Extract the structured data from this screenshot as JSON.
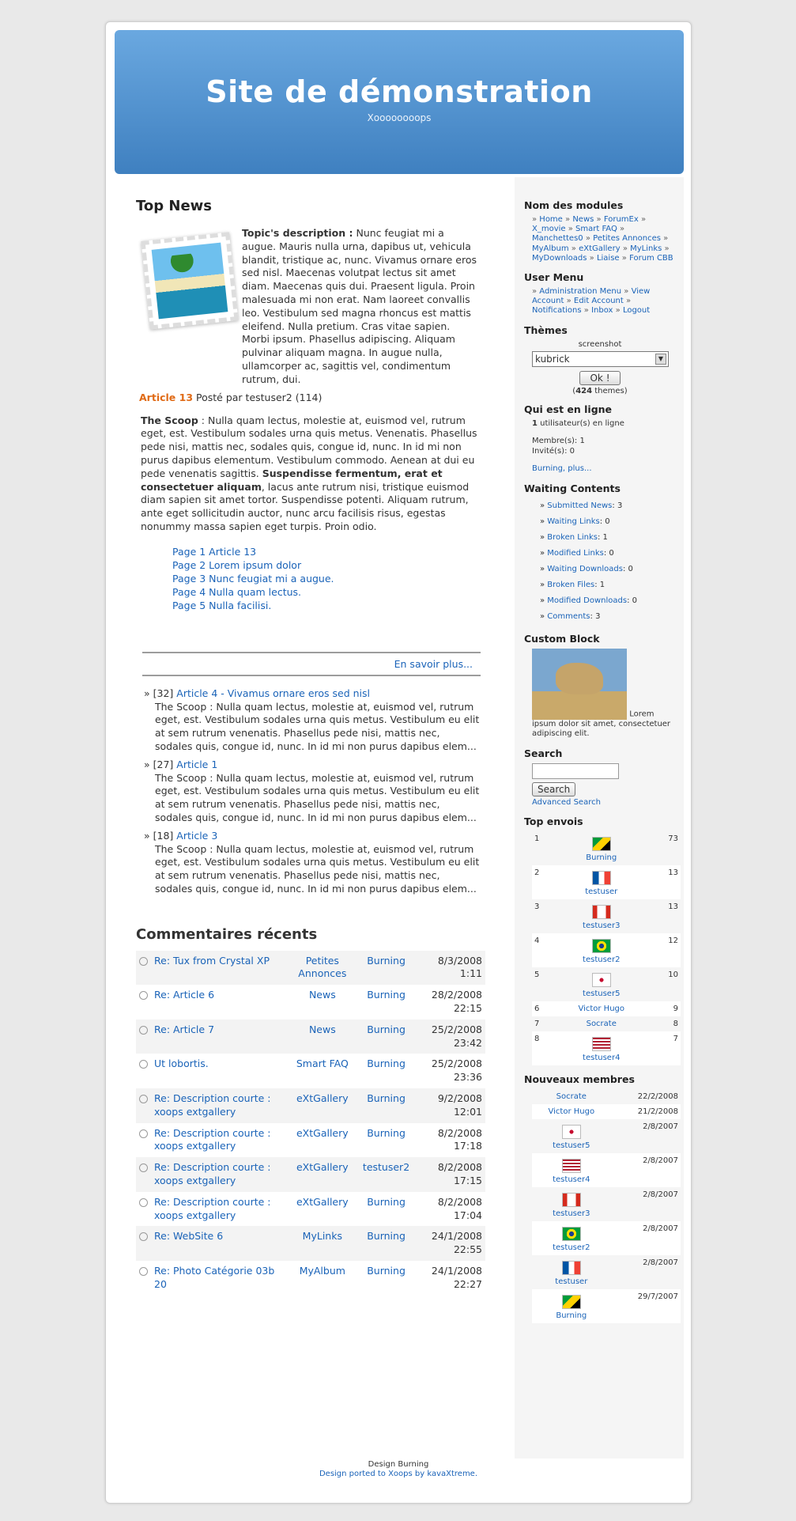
{
  "header": {
    "title": "Site de démonstration",
    "slogan": "Xoooooooops"
  },
  "topnews": {
    "title": "Top News",
    "desc_label": "Topic's description :",
    "desc_text": "Nunc feugiat mi a augue. Mauris nulla urna, dapibus ut, vehicula blandit, tristique ac, nunc. Vivamus ornare eros sed nisl. Maecenas volutpat lectus sit amet diam. Maecenas quis dui. Praesent ligula. Proin malesuada mi non erat. Nam laoreet convallis leo. Vestibulum sed magna rhoncus est mattis eleifend. Nulla pretium. Cras vitae sapien. Morbi ipsum. Phasellus adipiscing. Aliquam pulvinar aliquam magna. In augue nulla, ullamcorper ac, sagittis vel, condimentum rutrum, dui.",
    "article_link": "Article 13",
    "posted_by": "Posté par testuser2 (114)",
    "scoop_label": "The Scoop",
    "scoop_text1": ": Nulla quam lectus, molestie at, euismod vel, rutrum eget, est. Vestibulum sodales urna quis metus. Venenatis. Phasellus pede nisi, mattis nec, sodales quis, congue id, nunc. In id mi non purus dapibus elementum. Vestibulum commodo. Aenean at dui eu pede venenatis sagittis.",
    "scoop_bold": "Suspendisse fermentum, erat et consectetuer aliquam",
    "scoop_text2": ", lacus ante rutrum nisi, tristique euismod diam sapien sit amet tortor. Suspendisse potenti. Aliquam rutrum, ante eget sollicitudin auctor, nunc arcu facilisis risus, egestas nonummy massa sapien eget turpis. Proin odio.",
    "pages": [
      "Page 1 Article 13",
      "Page 2 Lorem ipsum dolor",
      "Page 3 Nunc feugiat mi a augue.",
      "Page 4 Nulla quam lectus.",
      "Page 5 Nulla facilisi."
    ],
    "more": "En savoir plus...",
    "list": [
      {
        "count": "» [32]",
        "title": "Article 4 - Vivamus ornare eros sed nisl",
        "summary": "The Scoop : Nulla quam lectus, molestie at, euismod vel, rutrum eget, est. Vestibulum sodales urna quis metus. Vestibulum eu elit at sem rutrum venenatis. Phasellus pede nisi, mattis nec, sodales quis, congue id, nunc. In id mi non purus dapibus elem..."
      },
      {
        "count": "» [27]",
        "title": "Article 1",
        "summary": "The Scoop : Nulla quam lectus, molestie at, euismod vel, rutrum eget, est. Vestibulum sodales urna quis metus. Vestibulum eu elit at sem rutrum venenatis. Phasellus pede nisi, mattis nec, sodales quis, congue id, nunc. In id mi non purus dapibus elem..."
      },
      {
        "count": "» [18]",
        "title": "Article 3",
        "summary": "The Scoop : Nulla quam lectus, molestie at, euismod vel, rutrum eget, est. Vestibulum sodales urna quis metus. Vestibulum eu elit at sem rutrum venenatis. Phasellus pede nisi, mattis nec, sodales quis, congue id, nunc. In id mi non purus dapibus elem..."
      }
    ]
  },
  "comments": {
    "title": "Commentaires récents",
    "rows": [
      {
        "title": "Re: Tux from Crystal XP",
        "section": "Petites Annonces",
        "user": "Burning",
        "date": "8/3/2008 1:11"
      },
      {
        "title": "Re: Article 6",
        "section": "News",
        "user": "Burning",
        "date": "28/2/2008 22:15"
      },
      {
        "title": "Re: Article 7",
        "section": "News",
        "user": "Burning",
        "date": "25/2/2008 23:42"
      },
      {
        "title": "Ut lobortis.",
        "section": "Smart FAQ",
        "user": "Burning",
        "date": "25/2/2008 23:36"
      },
      {
        "title": "Re: Description courte : xoops extgallery",
        "section": "eXtGallery",
        "user": "Burning",
        "date": "9/2/2008 12:01"
      },
      {
        "title": "Re: Description courte : xoops extgallery",
        "section": "eXtGallery",
        "user": "Burning",
        "date": "8/2/2008 17:18"
      },
      {
        "title": "Re: Description courte : xoops extgallery",
        "section": "eXtGallery",
        "user": "testuser2",
        "date": "8/2/2008 17:15"
      },
      {
        "title": "Re: Description courte : xoops extgallery",
        "section": "eXtGallery",
        "user": "Burning",
        "date": "8/2/2008 17:04"
      },
      {
        "title": "Re: WebSite 6",
        "section": "MyLinks",
        "user": "Burning",
        "date": "24/1/2008 22:55"
      },
      {
        "title": "Re: Photo Catégorie 03b 20",
        "section": "MyAlbum",
        "user": "Burning",
        "date": "24/1/2008 22:27"
      }
    ]
  },
  "sidebar": {
    "modules_title": "Nom des modules",
    "modules": [
      "Home",
      "News",
      "ForumEx",
      "X_movie",
      "Smart FAQ",
      "Manchettes0",
      "Petites Annonces",
      "MyAlbum",
      "eXtGallery",
      "MyLinks",
      "MyDownloads",
      "Liaise",
      "Forum CBB"
    ],
    "usermenu_title": "User Menu",
    "usermenu": [
      "Administration Menu",
      "View Account",
      "Edit Account",
      "Notifications",
      "Inbox",
      "Logout"
    ],
    "themes_title": "Thèmes",
    "themes_screenshot": "screenshot",
    "themes_selected": "kubrick",
    "themes_button": "Ok !",
    "themes_count_pre": "(",
    "themes_count": "424",
    "themes_count_post": " themes)",
    "online_title": "Qui est en ligne",
    "online_count": "1",
    "online_text": " utilisateur(s) en ligne",
    "members": "Membre(s): 1",
    "guests": "Invité(s): 0",
    "online_more": "Burning, plus...",
    "waiting_title": "Waiting Contents",
    "waiting": [
      {
        "label": "Submitted News",
        "value": ": 3"
      },
      {
        "label": "Waiting Links",
        "value": ": 0"
      },
      {
        "label": "Broken Links",
        "value": ": 1"
      },
      {
        "label": "Modified Links",
        "value": ": 0"
      },
      {
        "label": "Waiting Downloads",
        "value": ": 0"
      },
      {
        "label": "Broken Files",
        "value": ": 1"
      },
      {
        "label": "Modified Downloads",
        "value": ": 0"
      },
      {
        "label": "Comments",
        "value": ": 3"
      }
    ],
    "custom_title": "Custom Block",
    "custom_text": "Lorem ipsum dolor sit amet, consectetuer adipiscing elit.",
    "search_title": "Search",
    "search_button": "Search",
    "search_advanced": "Advanced Search",
    "top_title": "Top envois",
    "top": [
      {
        "rank": "1",
        "user": "Burning",
        "count": "73",
        "flag": "jm"
      },
      {
        "rank": "2",
        "user": "testuser",
        "count": "13",
        "flag": "fr"
      },
      {
        "rank": "3",
        "user": "testuser3",
        "count": "13",
        "flag": "ca"
      },
      {
        "rank": "4",
        "user": "testuser2",
        "count": "12",
        "flag": "br"
      },
      {
        "rank": "5",
        "user": "testuser5",
        "count": "10",
        "flag": "kr"
      },
      {
        "rank": "6",
        "user": "Victor Hugo",
        "count": "9",
        "flag": ""
      },
      {
        "rank": "7",
        "user": "Socrate",
        "count": "8",
        "flag": ""
      },
      {
        "rank": "8",
        "user": "testuser4",
        "count": "7",
        "flag": "us"
      }
    ],
    "new_title": "Nouveaux membres",
    "new": [
      {
        "user": "Socrate",
        "date": "22/2/2008",
        "flag": ""
      },
      {
        "user": "Victor Hugo",
        "date": "21/2/2008",
        "flag": ""
      },
      {
        "user": "testuser5",
        "date": "2/8/2007",
        "flag": "kr"
      },
      {
        "user": "testuser4",
        "date": "2/8/2007",
        "flag": "us"
      },
      {
        "user": "testuser3",
        "date": "2/8/2007",
        "flag": "ca"
      },
      {
        "user": "testuser2",
        "date": "2/8/2007",
        "flag": "br"
      },
      {
        "user": "testuser",
        "date": "2/8/2007",
        "flag": "fr"
      },
      {
        "user": "Burning",
        "date": "29/7/2007",
        "flag": "jm"
      }
    ]
  },
  "footer": {
    "line1": "Design Burning",
    "line2": "Design ported to Xoops by kavaXtreme."
  }
}
